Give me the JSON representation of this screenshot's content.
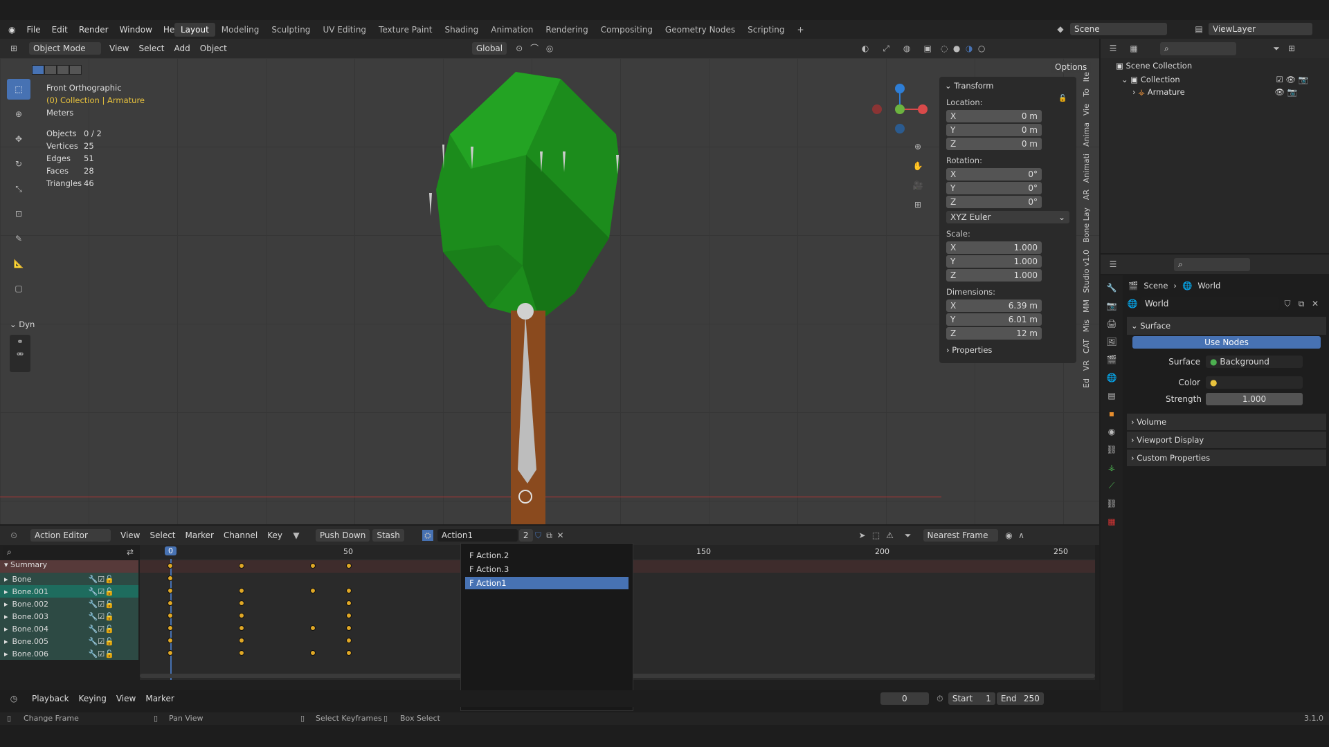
{
  "app_menu": [
    "File",
    "Edit",
    "Render",
    "Window",
    "Help"
  ],
  "workspaces": [
    "Layout",
    "Modeling",
    "Sculpting",
    "UV Editing",
    "Texture Paint",
    "Shading",
    "Animation",
    "Rendering",
    "Compositing",
    "Geometry Nodes",
    "Scripting",
    "+"
  ],
  "active_workspace": "Layout",
  "scene_name": "Scene",
  "view_layer": "ViewLayer",
  "viewport_header": {
    "mode": "Object Mode",
    "menus": [
      "View",
      "Select",
      "Add",
      "Object"
    ],
    "orientation": "Global",
    "options": "Options"
  },
  "viewport_info": {
    "view": "Front Orthographic",
    "collection": "(0) Collection | Armature",
    "units": "Meters",
    "stats": [
      {
        "k": "Objects",
        "v": "0 / 2"
      },
      {
        "k": "Vertices",
        "v": "25"
      },
      {
        "k": "Edges",
        "v": "51"
      },
      {
        "k": "Faces",
        "v": "28"
      },
      {
        "k": "Triangles",
        "v": "46"
      }
    ]
  },
  "tool_panel_label": "Dyn",
  "transform": {
    "title": "Transform",
    "location_label": "Location:",
    "rotation_label": "Rotation:",
    "scale_label": "Scale:",
    "dimensions_label": "Dimensions:",
    "location": [
      {
        "a": "X",
        "v": "0 m"
      },
      {
        "a": "Y",
        "v": "0 m"
      },
      {
        "a": "Z",
        "v": "0 m"
      }
    ],
    "rotation": [
      {
        "a": "X",
        "v": "0°"
      },
      {
        "a": "Y",
        "v": "0°"
      },
      {
        "a": "Z",
        "v": "0°"
      }
    ],
    "rotation_mode": "XYZ Euler",
    "scale": [
      {
        "a": "X",
        "v": "1.000"
      },
      {
        "a": "Y",
        "v": "1.000"
      },
      {
        "a": "Z",
        "v": "1.000"
      }
    ],
    "dimensions": [
      {
        "a": "X",
        "v": "6.39 m"
      },
      {
        "a": "Y",
        "v": "6.01 m"
      },
      {
        "a": "Z",
        "v": "12 m"
      }
    ],
    "properties": "Properties"
  },
  "sidebar_tabs": [
    "Ite",
    "To",
    "Vie",
    "Anima",
    "Animati",
    "AR",
    "Bone Lay",
    "Studio v1.0",
    "MM",
    "Mis",
    "CAT",
    "VR",
    "Ed"
  ],
  "outliner": {
    "root": "Scene Collection",
    "collection": "Collection",
    "object": "Armature"
  },
  "properties": {
    "breadcrumb_scene": "Scene",
    "breadcrumb_world": "World",
    "world_name": "World",
    "surface_section": "Surface",
    "use_nodes": "Use Nodes",
    "surface_label": "Surface",
    "surface_value": "Background",
    "color_label": "Color",
    "strength_label": "Strength",
    "strength_value": "1.000",
    "sections": [
      "Volume",
      "Viewport Display",
      "Custom Properties"
    ]
  },
  "action_editor": {
    "mode": "Action Editor",
    "menus": [
      "View",
      "Select",
      "Marker",
      "Channel",
      "Key"
    ],
    "push_down": "Push Down",
    "stash": "Stash",
    "action_name": "Action1",
    "users": "2",
    "snap": "Nearest Frame",
    "ruler": [
      "0",
      "50",
      "150",
      "200",
      "250"
    ],
    "channels": [
      "Summary",
      "Bone",
      "Bone.001",
      "Bone.002",
      "Bone.003",
      "Bone.004",
      "Bone.005",
      "Bone.006"
    ],
    "keyframes": [
      [
        0,
        20,
        40,
        50
      ],
      [
        0
      ],
      [
        0,
        20,
        40,
        50
      ],
      [
        0,
        20,
        50
      ],
      [
        0,
        20,
        50
      ],
      [
        0,
        20,
        40,
        50
      ],
      [
        0,
        20,
        50
      ],
      [
        0,
        20,
        40,
        50
      ]
    ]
  },
  "action_dropdown": [
    "F Action.2",
    "F Action.3",
    "F Action1"
  ],
  "action_dropdown_selected": "F Action1",
  "timeline": {
    "menus": [
      "Playback",
      "Keying",
      "View",
      "Marker"
    ],
    "current": "0",
    "start_label": "Start",
    "start": "1",
    "end_label": "End",
    "end": "250"
  },
  "status_bar": {
    "items": [
      "Change Frame",
      "Pan View",
      "Select Keyframes",
      "Box Select"
    ],
    "version": "3.1.0"
  },
  "colors": {
    "accent": "#4772b3",
    "keyframe": "#e0a826",
    "tree_leaves": "#1f8a1f",
    "trunk": "#8a4a1e",
    "bone": "#b8b8b8"
  }
}
